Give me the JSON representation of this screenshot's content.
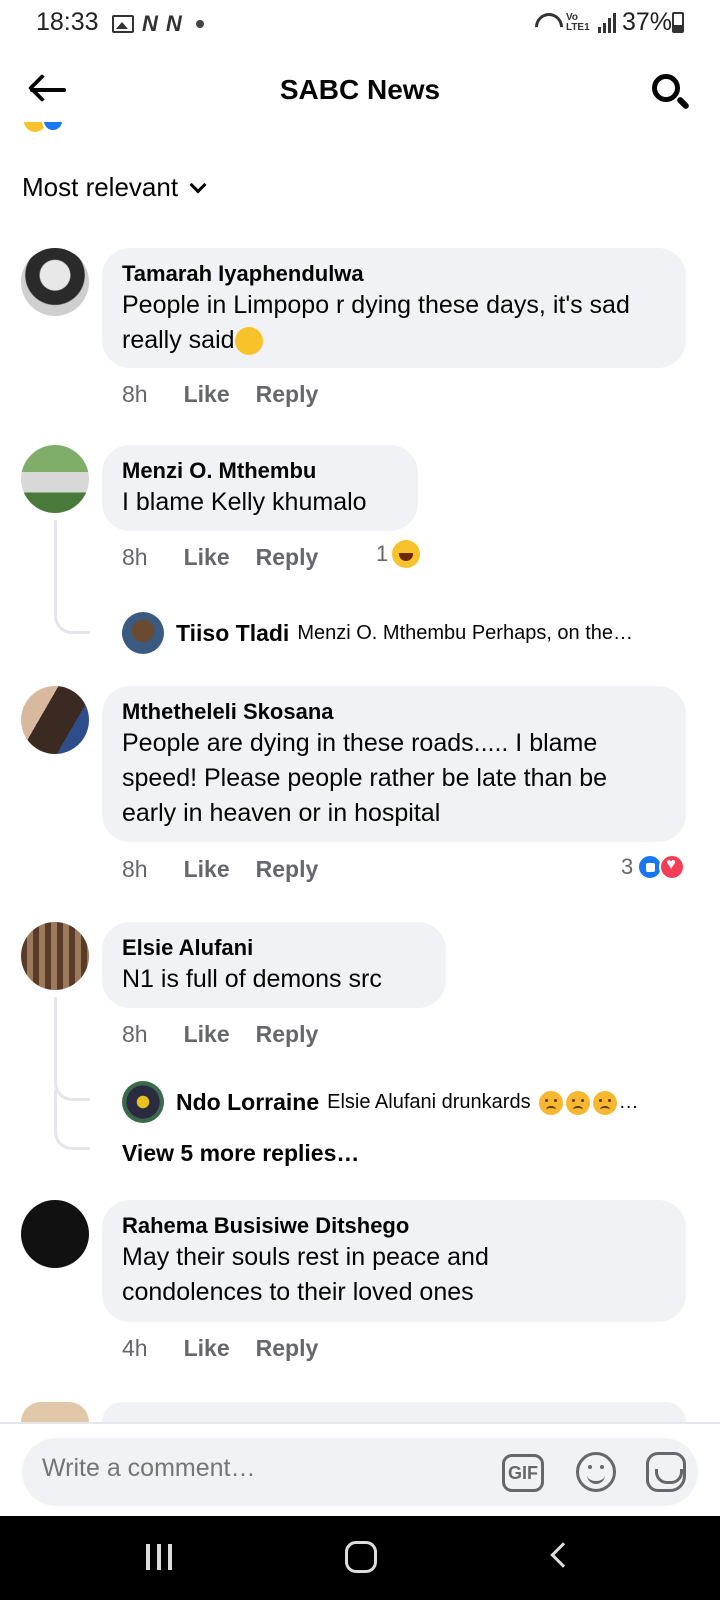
{
  "status_bar": {
    "time": "18:33",
    "notif_n1": "N",
    "notif_n2": "N",
    "lte": "Vo LTE1",
    "battery": "37%"
  },
  "header": {
    "title": "SABC News"
  },
  "sort": {
    "label": "Most relevant"
  },
  "comments": [
    {
      "author": "Tamarah Iyaphendulwa",
      "text": "People in Limpopo r dying these days, it's sad really said",
      "emoji": "crying-face",
      "time": "8h",
      "like": "Like",
      "reply": "Reply"
    },
    {
      "author": "Menzi O. Mthembu",
      "text": "I blame Kelly khumalo",
      "time": "8h",
      "like": "Like",
      "reply": "Reply",
      "reaction_count": "1",
      "reply_preview": {
        "author": "Tiiso Tladi",
        "text": "Menzi O. Mthembu Perhaps, on the…"
      }
    },
    {
      "author": "Mthetheleli Skosana",
      "text_line1": "People are dying in these roads..... I blame",
      "text_line2": "speed! Please people rather be late than be",
      "text_line3": "early in heaven or in hospital",
      "time": "8h",
      "like": "Like",
      "reply": "Reply",
      "reaction_count": "3"
    },
    {
      "author": "Elsie Alufani",
      "text": "N1 is full of demons src",
      "time": "8h",
      "like": "Like",
      "reply": "Reply",
      "reply_preview": {
        "author": "Ndo Lorraine",
        "text": "Elsie Alufani drunkards"
      },
      "view_more": "View 5 more replies…"
    },
    {
      "author": "Rahema Busisiwe Ditshego",
      "text_line1": "May their souls rest in peace and",
      "text_line2": "condolences to their loved ones",
      "time": "4h",
      "like": "Like",
      "reply": "Reply"
    }
  ],
  "composer": {
    "placeholder": "Write a comment…",
    "gif_label": "GIF"
  },
  "colors": {
    "bubble": "#f0f2f5",
    "secondary_text": "#65676b",
    "like_blue": "#1877f2",
    "love_red": "#f33e58"
  }
}
